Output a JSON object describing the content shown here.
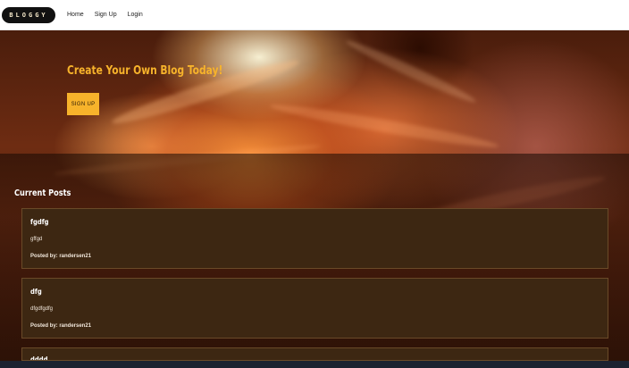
{
  "nav": {
    "logo": "BLOGGY",
    "links": [
      "Home",
      "Sign Up",
      "Login"
    ]
  },
  "hero": {
    "title": "Create Your Own Blog Today!",
    "button_label": "SIGN UP"
  },
  "section_title": "Current Posts",
  "posts": [
    {
      "title": "fgdfg",
      "body": "gffgd",
      "author": "Posted by: randersen21"
    },
    {
      "title": "dfg",
      "body": "dfgdfgdfg",
      "author": "Posted by: randersen21"
    },
    {
      "title": "dddd",
      "body": "",
      "author": ""
    }
  ],
  "colors": {
    "accent": "#f7b32b",
    "card_bg": "#3d2712",
    "nav_bg": "#ffffff"
  }
}
